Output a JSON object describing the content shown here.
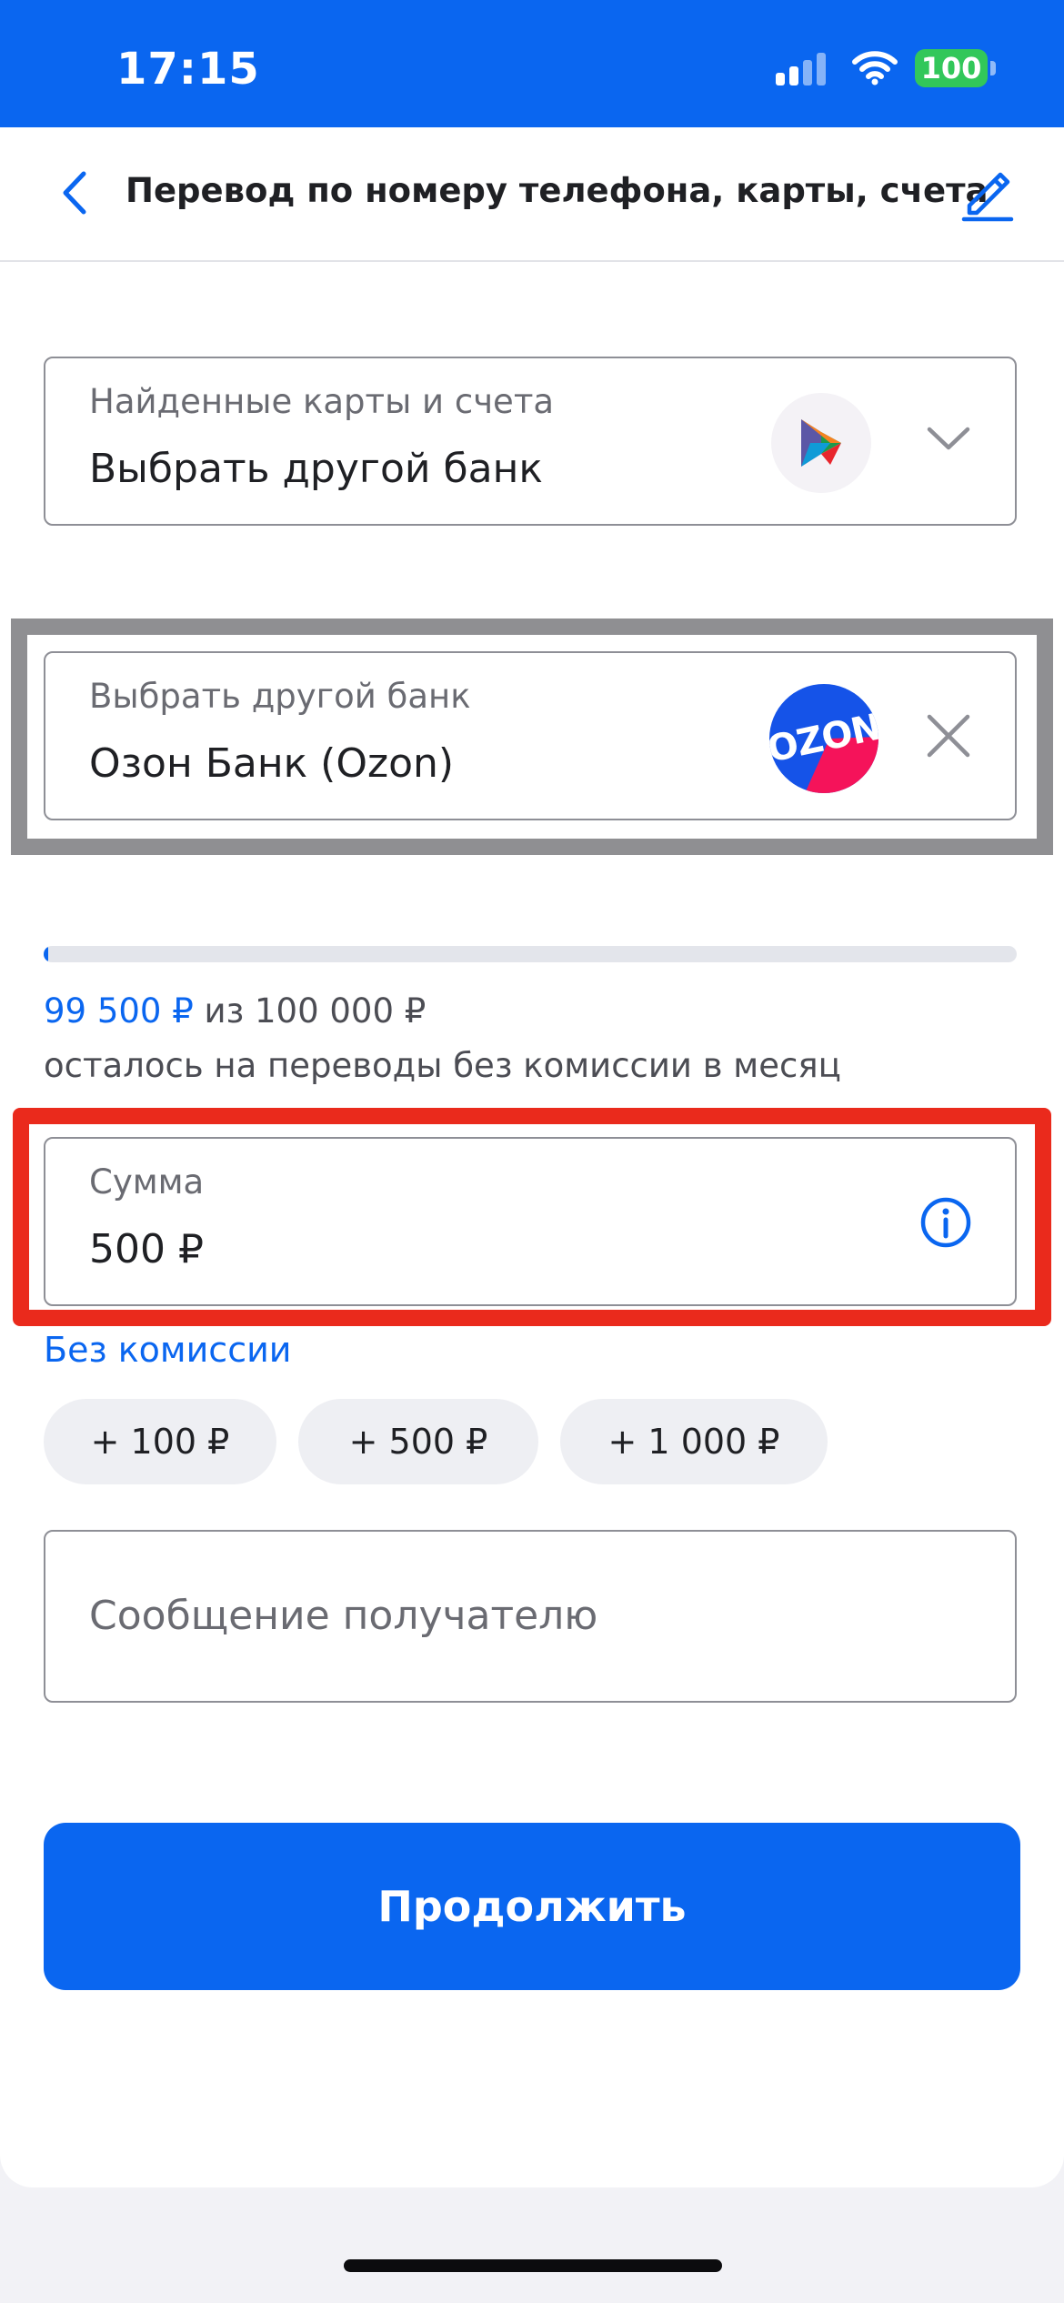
{
  "status_bar": {
    "time": "17:15",
    "battery": "100"
  },
  "navbar": {
    "title": "Перевод по номеру телефона, карты, счета"
  },
  "found_cards": {
    "label": "Найденные карты и счета",
    "value": "Выбрать другой банк"
  },
  "bank_select": {
    "label": "Выбрать другой банк",
    "value": "Озон Банк (Ozon)",
    "logo_text": "OZON"
  },
  "limit": {
    "amount": "99 500 ₽",
    "of_total": " из 100 000 ₽",
    "subtitle": "осталось на переводы без комиссии в месяц",
    "progress_fraction": 0.005
  },
  "amount_field": {
    "label": "Сумма",
    "value": "500 ₽"
  },
  "commission_note": "Без комиссии",
  "quick_amounts": [
    "+ 100 ₽",
    "+ 500 ₽",
    "+ 1 000 ₽"
  ],
  "message_field": {
    "placeholder": "Сообщение получателю"
  },
  "continue_button": "Продолжить",
  "colors": {
    "brand_blue": "#0a66f0",
    "highlight_gray": "#8f8f92",
    "highlight_red": "#ea2a1c",
    "ozon_blue": "#1553e8",
    "ozon_pink": "#f5135a"
  },
  "icons": [
    "back-chevron-icon",
    "edit-pencil-icon",
    "sbp-logo-icon",
    "chevron-down-icon",
    "close-icon",
    "info-icon",
    "signal-icon",
    "wifi-icon"
  ]
}
